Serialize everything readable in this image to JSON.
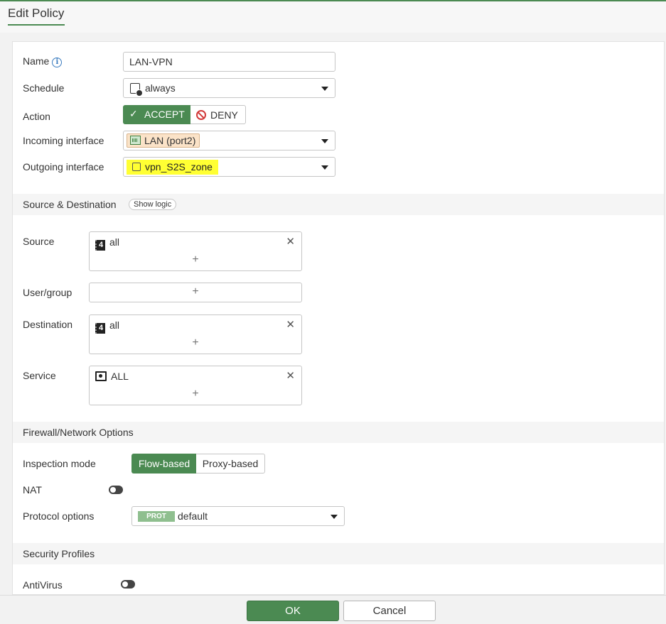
{
  "header": {
    "title": "Edit Policy"
  },
  "form": {
    "name": {
      "label": "Name",
      "value": "LAN-VPN"
    },
    "schedule": {
      "label": "Schedule",
      "value": "always"
    },
    "action": {
      "label": "Action",
      "accept": "ACCEPT",
      "deny": "DENY",
      "selected": "ACCEPT"
    },
    "incoming": {
      "label": "Incoming interface",
      "value": "LAN (port2)"
    },
    "outgoing": {
      "label": "Outgoing interface",
      "value": "vpn_S2S_zone"
    }
  },
  "source_destination": {
    "title": "Source & Destination",
    "show_logic": "Show logic",
    "source": {
      "label": "Source",
      "entries": [
        "all"
      ]
    },
    "user_group": {
      "label": "User/group",
      "entries": []
    },
    "destination": {
      "label": "Destination",
      "entries": [
        "all"
      ]
    },
    "service": {
      "label": "Service",
      "entries": [
        "ALL"
      ]
    },
    "add_symbol": "+",
    "remove_symbol": "✕",
    "address_icon_text": "4"
  },
  "firewall_options": {
    "title": "Firewall/Network Options",
    "inspection": {
      "label": "Inspection mode",
      "flow": "Flow-based",
      "proxy": "Proxy-based",
      "selected": "Flow-based"
    },
    "nat": {
      "label": "NAT",
      "enabled": false
    },
    "protocol": {
      "label": "Protocol options",
      "badge": "PROT",
      "value": "default"
    }
  },
  "security_profiles": {
    "title": "Security Profiles",
    "antivirus": {
      "label": "AntiVirus",
      "enabled": false
    }
  },
  "footer": {
    "ok": "OK",
    "cancel": "Cancel"
  },
  "colors": {
    "accent": "#4b8a52",
    "highlight": "#ffff33",
    "deny": "#d23a3a"
  }
}
